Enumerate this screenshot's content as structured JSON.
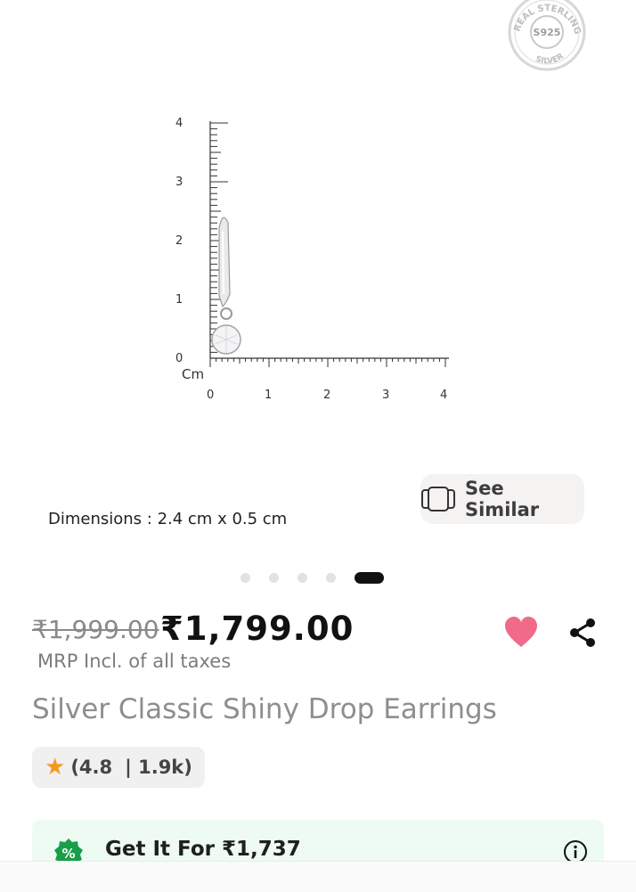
{
  "seal": {
    "line_top": "REAL STERLING",
    "center": "S925",
    "line_bottom": "SILVER"
  },
  "ruler": {
    "unit": "Cm",
    "y_labels": [
      "4",
      "3",
      "2",
      "1",
      "0"
    ],
    "x_labels": [
      "0",
      "1",
      "2",
      "3",
      "4"
    ]
  },
  "see_similar": {
    "label": "See Similar",
    "icon": "cards-stack-icon"
  },
  "dimensions": "Dimensions : 2.4 cm x 0.5 cm",
  "carousel": {
    "count": 5,
    "active": 5
  },
  "price": {
    "mrp": "₹1,999.00",
    "current": "₹1,799.00",
    "taxes": "MRP Incl. of all taxes"
  },
  "actions": {
    "wishlist_icon": "heart-icon",
    "share_icon": "share-icon",
    "wishlist_color": "#f06a8a"
  },
  "product": {
    "title": "Silver Classic Shiny Drop Earrings"
  },
  "rating": {
    "value": "(4.8",
    "count": "| 1.9k)"
  },
  "offer": {
    "text": "Get It For ₹1,737",
    "badge_icon": "discount-badge-icon",
    "info_icon": "info-icon",
    "badge_color": "#1a9d4b"
  }
}
